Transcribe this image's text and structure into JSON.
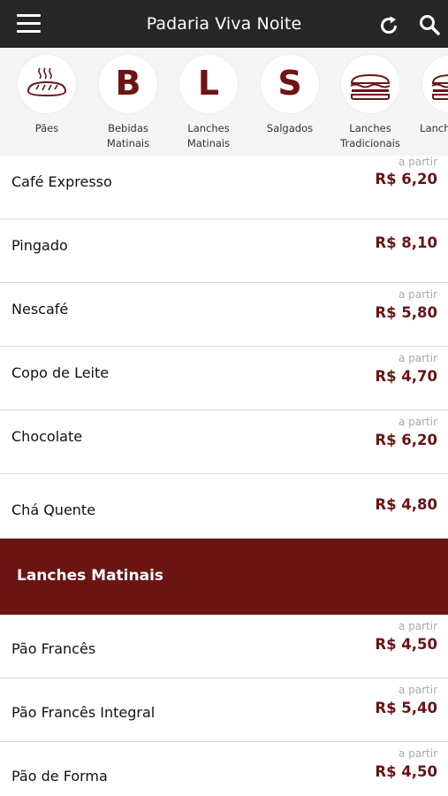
{
  "header": {
    "title": "Padaria Viva Noite"
  },
  "categories": [
    {
      "label": "Pães",
      "icon": "bread-icon"
    },
    {
      "label": "Bebidas Matinais",
      "letter": "B"
    },
    {
      "label": "Lanches Matinais",
      "letter": "L"
    },
    {
      "label": "Salgados",
      "letter": "S"
    },
    {
      "label": "Lanches Tradicionais",
      "icon": "sandwich-icon"
    },
    {
      "label": "Lanches Esp",
      "icon": "sandwich-icon"
    }
  ],
  "drinks": [
    {
      "name": "Café Expresso",
      "prefix": "a partir",
      "price": "R$ 6,20"
    },
    {
      "name": "Pingado",
      "prefix": "",
      "price": "R$ 8,10"
    },
    {
      "name": "Nescafé",
      "prefix": "a partir",
      "price": "R$ 5,80"
    },
    {
      "name": "Copo de Leite",
      "prefix": "a partir",
      "price": "R$ 4,70"
    },
    {
      "name": "Chocolate",
      "prefix": "a partir",
      "price": "R$ 6,20"
    },
    {
      "name": "Chá Quente",
      "prefix": "",
      "price": "R$ 4,80"
    }
  ],
  "section": {
    "title": "Lanches Matinais"
  },
  "snacks": [
    {
      "name": "Pão Francês",
      "prefix": "a partir",
      "price": "R$ 4,50"
    },
    {
      "name": "Pão Francês Integral",
      "prefix": "a partir",
      "price": "R$ 5,40"
    },
    {
      "name": "Pão de Forma",
      "prefix": "a partir",
      "price": "R$ 4,50"
    }
  ],
  "colors": {
    "accent": "#6a1414",
    "topbar": "#262626"
  }
}
